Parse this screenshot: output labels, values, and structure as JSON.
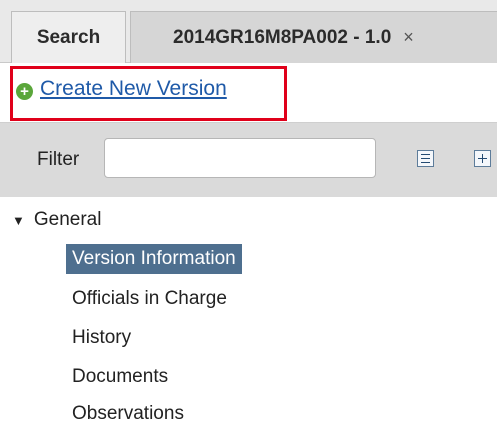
{
  "tabs": {
    "search_label": "Search",
    "version_label": "2014GR16M8PA002 - 1.0",
    "close_glyph": "×"
  },
  "actions": {
    "create_new_version_label": "Create New Version",
    "create_icon_glyph": "+",
    "create_icon_color": "#5aa63a",
    "highlight_color": "#e0001a"
  },
  "filter": {
    "label": "Filter",
    "value": "",
    "placeholder": "",
    "collapse_icon": "collapse-all-icon",
    "expand_icon": "expand-all-icon"
  },
  "tree": {
    "group_label": "General",
    "group_expanded": true,
    "selected_color": "#4e6f8f",
    "items": [
      {
        "label": "Version Information",
        "selected": true
      },
      {
        "label": "Officials in Charge",
        "selected": false
      },
      {
        "label": "History",
        "selected": false
      },
      {
        "label": "Documents",
        "selected": false
      },
      {
        "label": "Observations",
        "selected": false
      }
    ]
  }
}
